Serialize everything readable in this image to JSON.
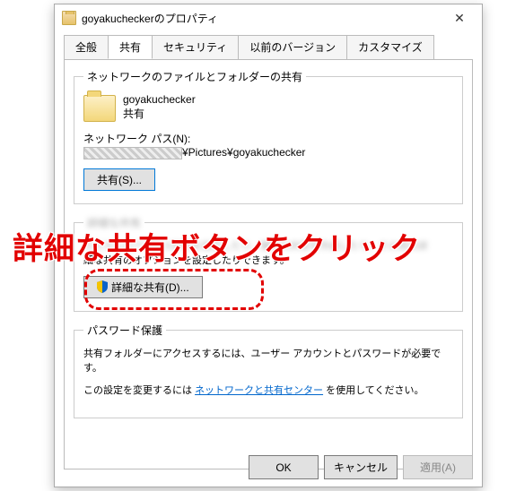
{
  "window": {
    "title": "goyakucheckerのプロパティ",
    "close_glyph": "✕"
  },
  "tabs": {
    "general": "全般",
    "sharing": "共有",
    "security": "セキュリティ",
    "previous": "以前のバージョン",
    "customize": "カスタマイズ"
  },
  "group1": {
    "legend": "ネットワークのファイルとフォルダーの共有",
    "name": "goyakuchecker",
    "status": "共有",
    "path_label": "ネットワーク パス(N):",
    "path_tail": "¥Pictures¥goyakuchecker",
    "share_btn": "共有(S)..."
  },
  "group2": {
    "legend": "詳細な共有",
    "desc_l1": "カスタムのアクセス許可を設定したり、複数の共有を作成したり、その他の詳",
    "desc_l2": "細な共有のオプションを設定したりできます。",
    "advanced_btn": "詳細な共有(D)..."
  },
  "group3": {
    "legend": "パスワード保護",
    "line1": "共有フォルダーにアクセスするには、ユーザー アカウントとパスワードが必要で",
    "line1b": "す。",
    "line2_pre": "この設定を変更するには ",
    "link": "ネットワークと共有センター",
    "line2_post": " を使用してください。"
  },
  "footer": {
    "ok": "OK",
    "cancel": "キャンセル",
    "apply": "適用(A)"
  },
  "annotation": {
    "text": "詳細な共有ボタンをクリック"
  }
}
